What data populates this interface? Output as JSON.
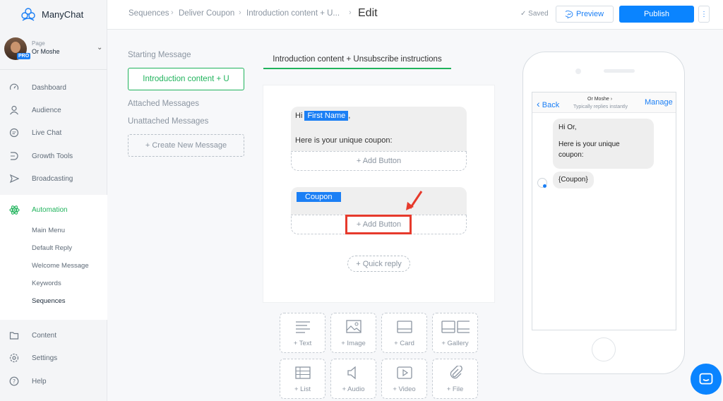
{
  "app": {
    "name": "ManyChat"
  },
  "page": {
    "label": "Page",
    "name": "Or Moshe",
    "badge": "PRO"
  },
  "nav": [
    {
      "label": "Dashboard",
      "icon": "dashboard-icon"
    },
    {
      "label": "Audience",
      "icon": "audience-icon"
    },
    {
      "label": "Live Chat",
      "icon": "live-chat-icon"
    },
    {
      "label": "Growth Tools",
      "icon": "growth-tools-icon"
    },
    {
      "label": "Broadcasting",
      "icon": "broadcasting-icon"
    },
    {
      "label": "Automation",
      "icon": "automation-icon",
      "active": true
    },
    {
      "label": "Content",
      "icon": "content-icon"
    },
    {
      "label": "Settings",
      "icon": "settings-icon"
    },
    {
      "label": "Help",
      "icon": "help-icon"
    }
  ],
  "automation_sub": [
    "Main Menu",
    "Default Reply",
    "Welcome Message",
    "Keywords",
    "Sequences"
  ],
  "breadcrumb": [
    "Sequences",
    "Deliver Coupon",
    "Introduction content + U...",
    "Edit"
  ],
  "status": {
    "saved": "Saved"
  },
  "actions": {
    "preview": "Preview",
    "publish": "Publish",
    "more": "⋮"
  },
  "sequence": {
    "starting_heading": "Starting Message",
    "starting_message": "Introduction content + U",
    "attached_heading": "Attached Messages",
    "unattached_heading": "Unattached Messages",
    "create_button": "+ Create New Message"
  },
  "editor": {
    "tab": "Introduction content + Unsubscribe instructions",
    "block1": {
      "greeting": "Hi",
      "variable": "First Name",
      "comma": ",",
      "line2": "Here is your unique coupon:"
    },
    "block2": {
      "variable": "Coupon"
    },
    "add_button": "+ Add Button",
    "quick_reply": "+ Quick reply",
    "content_blocks": [
      "+ Text",
      "+ Image",
      "+ Card",
      "+ Gallery",
      "+ List",
      "+ Audio",
      "+ Video",
      "+ File"
    ]
  },
  "phone": {
    "back": "Back",
    "chat_name": "Or Moshe",
    "chat_status": "Typically replies instantly",
    "manage": "Manage",
    "msg1_line1": "Hi Or,",
    "msg1_line2": "Here is your unique",
    "msg1_line3": "coupon:",
    "msg2": "{Coupon}"
  },
  "colors": {
    "accent_green": "#20b35c",
    "accent_blue": "#0a84ff",
    "highlight_red": "#e63a2c"
  }
}
